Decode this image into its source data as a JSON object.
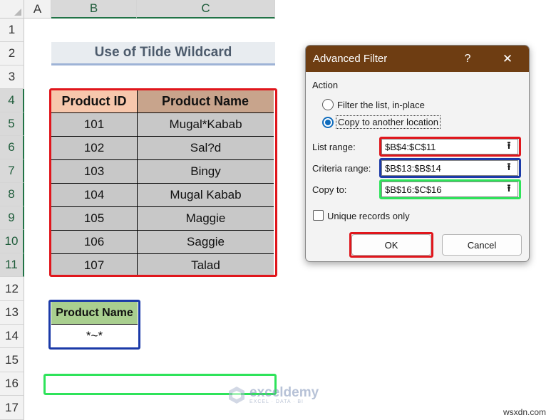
{
  "columns": [
    "A",
    "B",
    "C"
  ],
  "rows": [
    "1",
    "2",
    "3",
    "4",
    "5",
    "6",
    "7",
    "8",
    "9",
    "10",
    "11",
    "12",
    "13",
    "14",
    "15",
    "16",
    "17"
  ],
  "title": "Use of Tilde Wildcard",
  "table": {
    "headers": [
      "Product ID",
      "Product Name"
    ],
    "rows": [
      [
        "101",
        "Mugal*Kabab"
      ],
      [
        "102",
        "Sal?d"
      ],
      [
        "103",
        "Bingy"
      ],
      [
        "104",
        "Mugal Kabab"
      ],
      [
        "105",
        "Maggie"
      ],
      [
        "106",
        "Saggie"
      ],
      [
        "107",
        "Talad"
      ]
    ]
  },
  "criteria": {
    "header": "Product Name",
    "value": "*~*"
  },
  "dialog": {
    "title": "Advanced Filter",
    "help": "?",
    "close": "✕",
    "section": "Action",
    "options": [
      "Filter the list, in-place",
      "Copy to another location"
    ],
    "selected_option": 1,
    "list_range_label": "List range:",
    "list_range_value": "$B$4:$C$11",
    "criteria_range_label": "Criteria range:",
    "criteria_range_value": "$B$13:$B$14",
    "copy_to_label": "Copy to:",
    "copy_to_value": "$B$16:$C$16",
    "unique_label": "Unique records only",
    "unique_checked": false,
    "ok": "OK",
    "cancel": "Cancel"
  },
  "watermark": {
    "name": "exceldemy",
    "tagline": "EXCEL · DATA · BI"
  },
  "credit": "wsxdn.com",
  "colors": {
    "red_frame": "#e0161c",
    "blue_frame": "#1b3aa8",
    "green_frame": "#2ee35a",
    "dialog_title": "#6e3d12"
  }
}
